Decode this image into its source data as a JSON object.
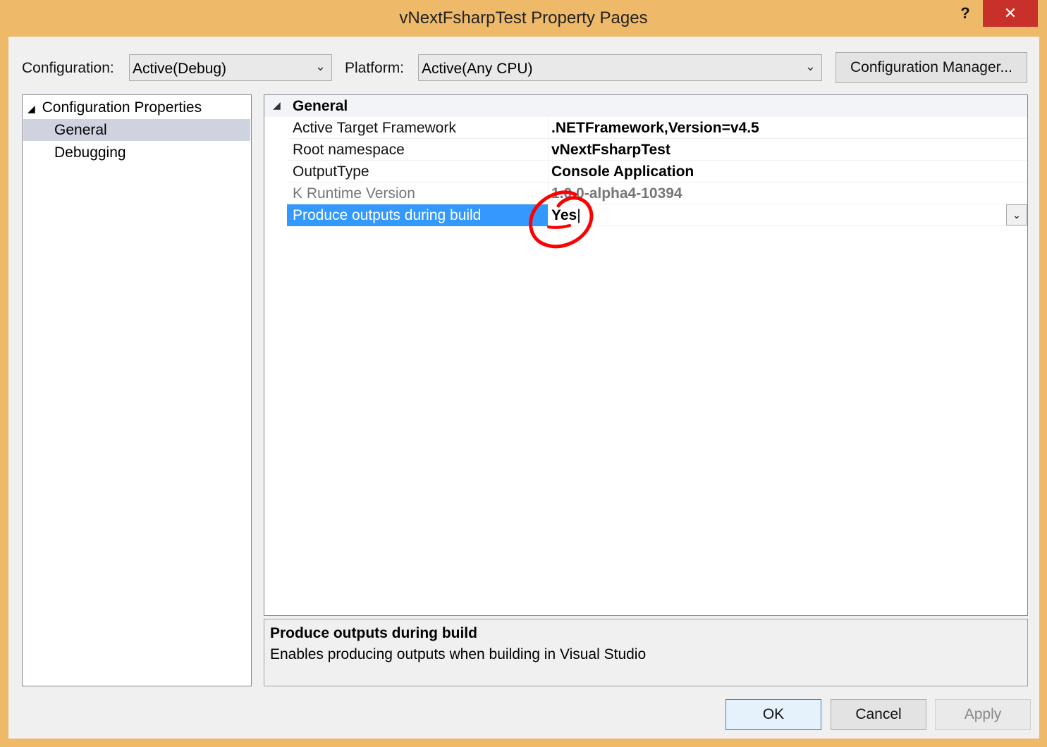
{
  "window": {
    "title": "vNextFsharpTest Property Pages",
    "help": "?",
    "close": "✕"
  },
  "toolbar": {
    "config_label": "Configuration:",
    "config_value": "Active(Debug)",
    "platform_label": "Platform:",
    "platform_value": "Active(Any CPU)",
    "config_manager": "Configuration Manager..."
  },
  "tree": {
    "root": "Configuration Properties",
    "items": [
      "General",
      "Debugging"
    ],
    "selected": "General"
  },
  "grid": {
    "category": "General",
    "rows": [
      {
        "name": "Active Target Framework",
        "value": ".NETFramework,Version=v4.5"
      },
      {
        "name": "Root namespace",
        "value": "vNextFsharpTest"
      },
      {
        "name": "OutputType",
        "value": "Console Application"
      },
      {
        "name": "K Runtime Version",
        "value": "1.0.0-alpha4-10394"
      },
      {
        "name": "Produce outputs during build",
        "value": "Yes"
      }
    ]
  },
  "description": {
    "title": "Produce outputs during build",
    "text": "Enables producing outputs when building in Visual Studio"
  },
  "buttons": {
    "ok": "OK",
    "cancel": "Cancel",
    "apply": "Apply"
  },
  "colors": {
    "frame": "#efb96a",
    "selection": "#3399ff",
    "close": "#c7312a",
    "annotation": "#ff0000"
  }
}
